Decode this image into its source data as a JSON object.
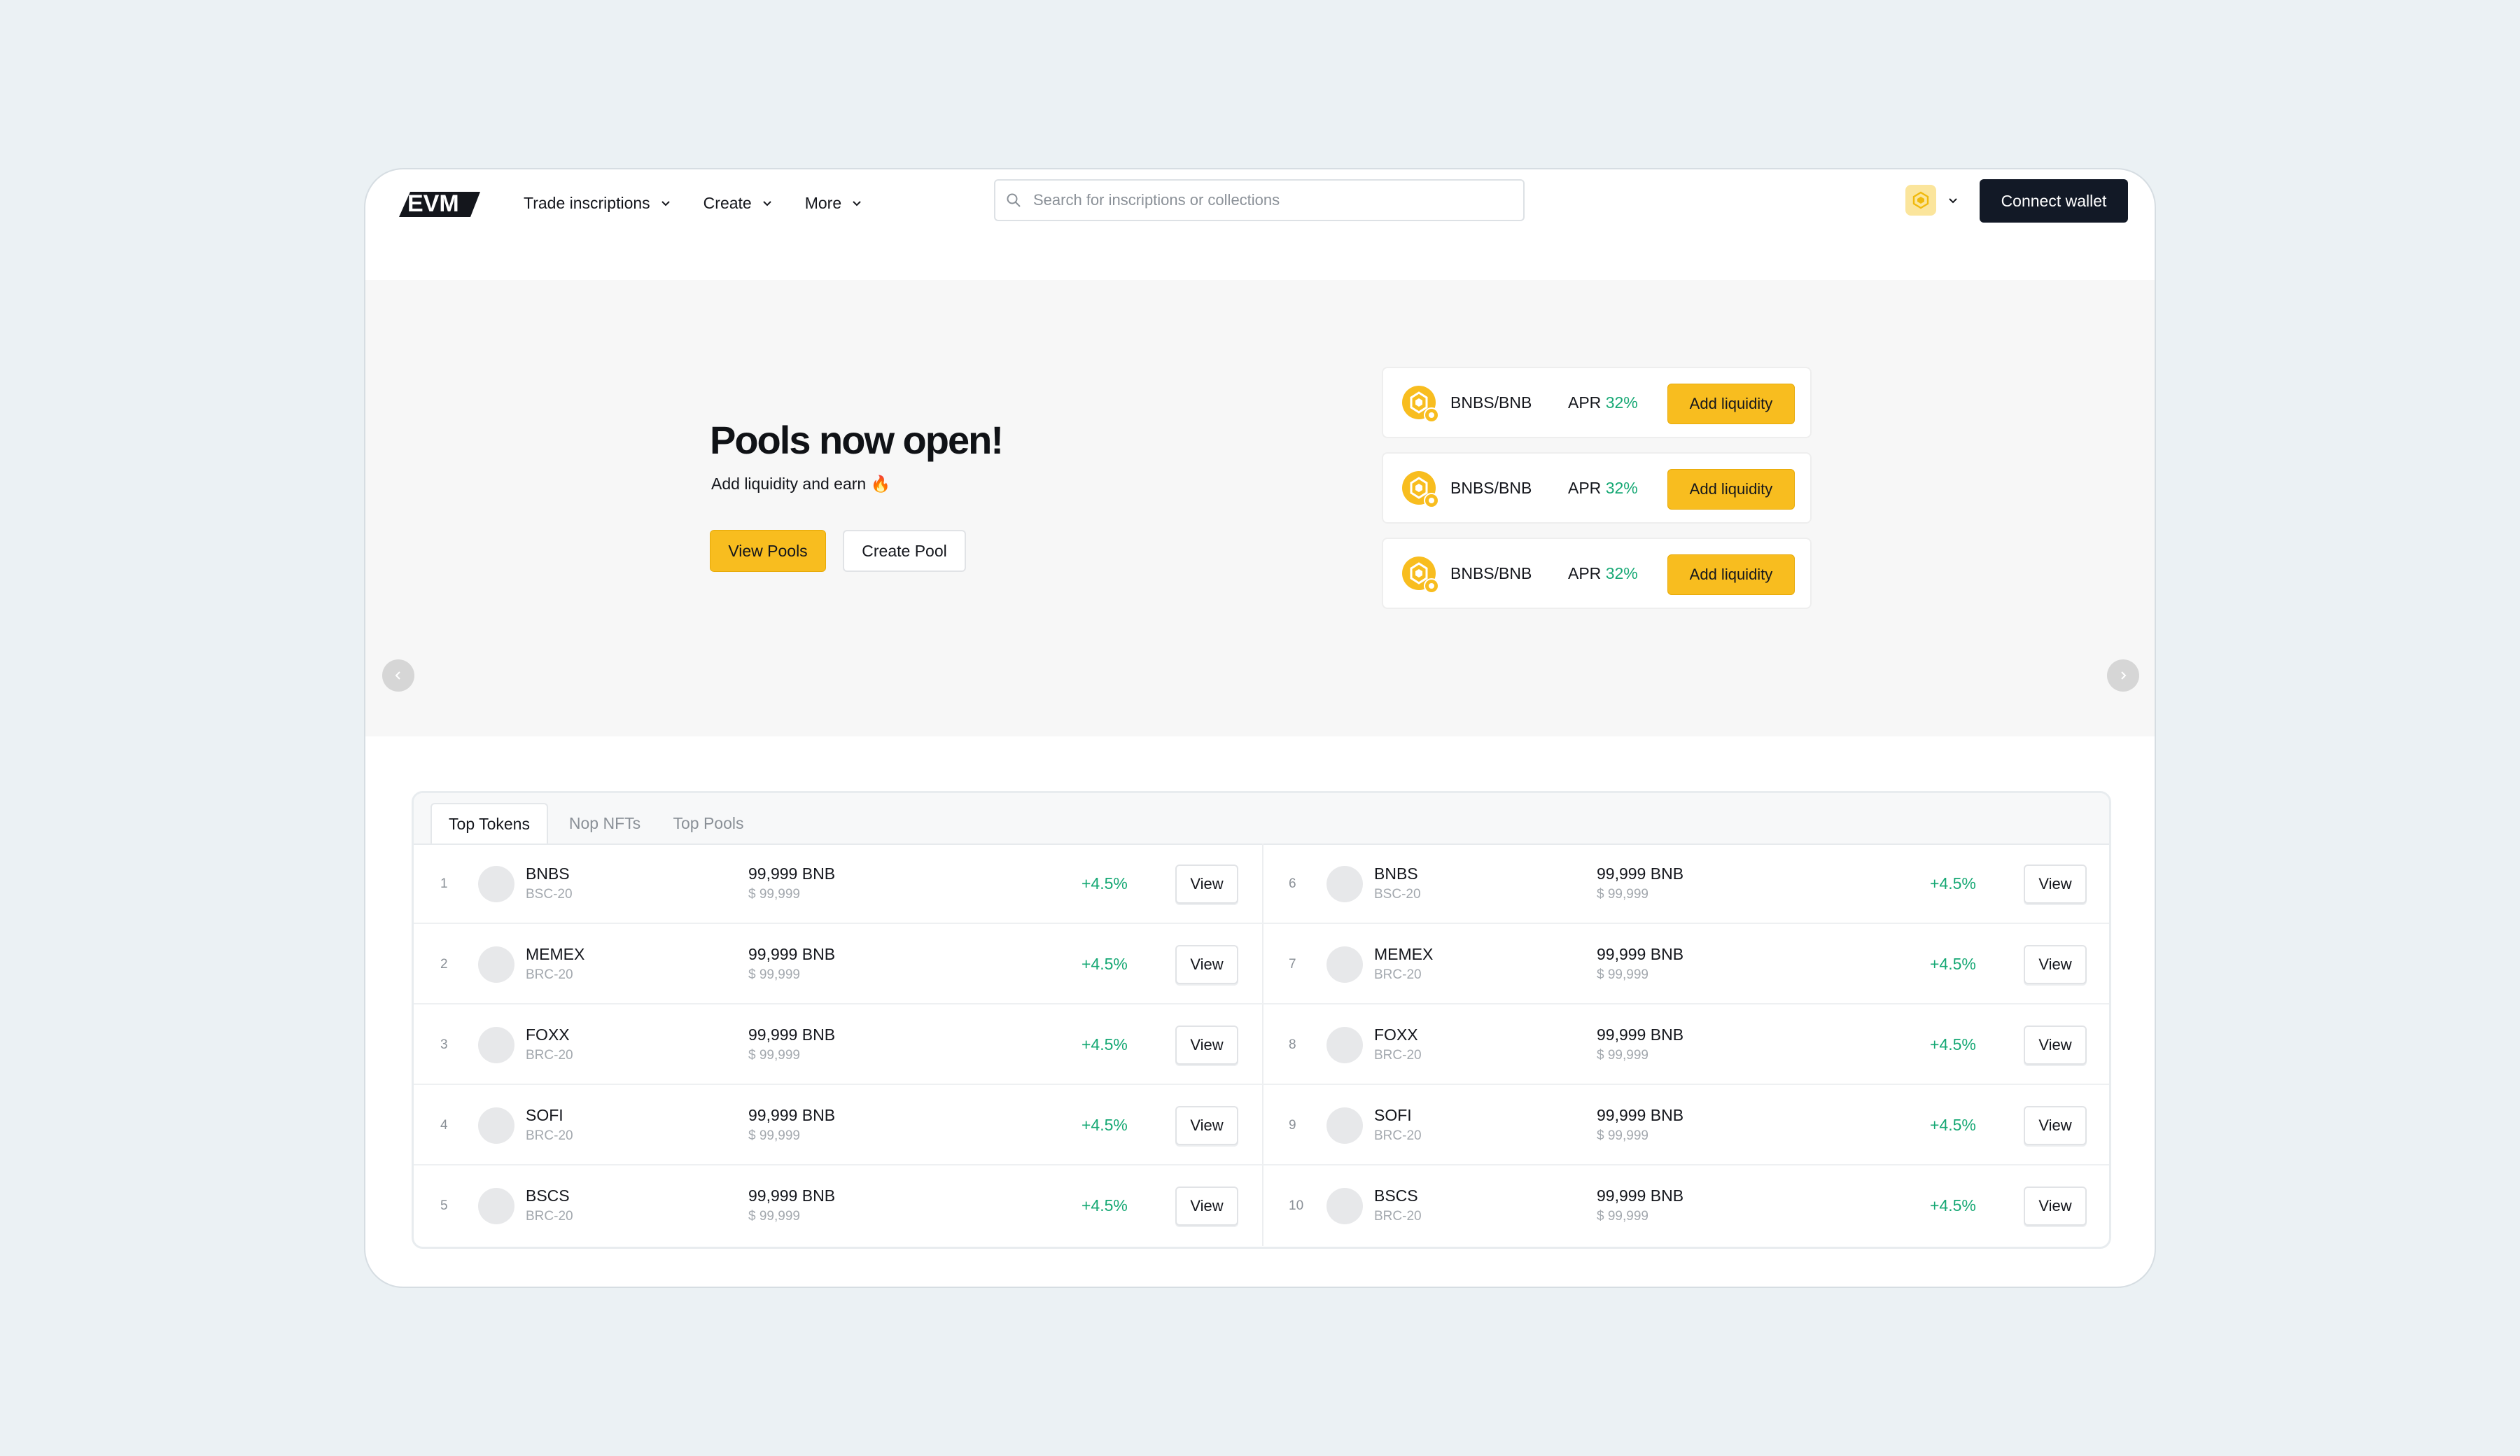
{
  "nav": {
    "logo_text": "EVM",
    "menu": [
      {
        "label": "Trade inscriptions"
      },
      {
        "label": "Create"
      },
      {
        "label": "More"
      }
    ],
    "search_placeholder": "Search for inscriptions or collections",
    "connect_label": "Connect wallet"
  },
  "hero": {
    "title": "Pools now open!",
    "subtitle": "Add liquidity and earn 🔥",
    "primary_label": "View Pools",
    "secondary_label": "Create Pool",
    "slide_count": 4,
    "active_slide": 1,
    "pools": [
      {
        "pair": "BNBS/BNB",
        "apr_label": "APR",
        "apr_value": "32%",
        "action": "Add liquidity"
      },
      {
        "pair": "BNBS/BNB",
        "apr_label": "APR",
        "apr_value": "32%",
        "action": "Add liquidity"
      },
      {
        "pair": "BNBS/BNB",
        "apr_label": "APR",
        "apr_value": "32%",
        "action": "Add liquidity"
      }
    ]
  },
  "table": {
    "tabs": [
      {
        "label": "Top Tokens",
        "active": true
      },
      {
        "label": "Nop NFTs",
        "active": false
      },
      {
        "label": "Top Pools",
        "active": false
      }
    ],
    "left_rows": [
      {
        "rank": "1",
        "name": "BNBS",
        "standard": "BSC-20",
        "price": "99,999 BNB",
        "usd": "$ 99,999",
        "change": "+4.5%",
        "action": "View"
      },
      {
        "rank": "2",
        "name": "MEMEX",
        "standard": "BRC-20",
        "price": "99,999 BNB",
        "usd": "$ 99,999",
        "change": "+4.5%",
        "action": "View"
      },
      {
        "rank": "3",
        "name": "FOXX",
        "standard": "BRC-20",
        "price": "99,999 BNB",
        "usd": "$ 99,999",
        "change": "+4.5%",
        "action": "View"
      },
      {
        "rank": "4",
        "name": "SOFI",
        "standard": "BRC-20",
        "price": "99,999 BNB",
        "usd": "$ 99,999",
        "change": "+4.5%",
        "action": "View"
      },
      {
        "rank": "5",
        "name": "BSCS",
        "standard": "BRC-20",
        "price": "99,999 BNB",
        "usd": "$ 99,999",
        "change": "+4.5%",
        "action": "View"
      }
    ],
    "right_rows": [
      {
        "rank": "6",
        "name": "BNBS",
        "standard": "BSC-20",
        "price": "99,999 BNB",
        "usd": "$ 99,999",
        "change": "+4.5%",
        "action": "View"
      },
      {
        "rank": "7",
        "name": "MEMEX",
        "standard": "BRC-20",
        "price": "99,999 BNB",
        "usd": "$ 99,999",
        "change": "+4.5%",
        "action": "View"
      },
      {
        "rank": "8",
        "name": "FOXX",
        "standard": "BRC-20",
        "price": "99,999 BNB",
        "usd": "$ 99,999",
        "change": "+4.5%",
        "action": "View"
      },
      {
        "rank": "9",
        "name": "SOFI",
        "standard": "BRC-20",
        "price": "99,999 BNB",
        "usd": "$ 99,999",
        "change": "+4.5%",
        "action": "View"
      },
      {
        "rank": "10",
        "name": "BSCS",
        "standard": "BRC-20",
        "price": "99,999 BNB",
        "usd": "$ 99,999",
        "change": "+4.5%",
        "action": "View"
      }
    ]
  },
  "colors": {
    "accent": "#f8bd1f",
    "positive": "#16a874",
    "dark_button": "#121926"
  },
  "icons": {
    "nav_dropdown": "chevron-down-icon",
    "search": "search-icon",
    "chain": "bnb-chain-icon",
    "pool": "bnb-token-icon",
    "prev": "chevron-left-icon",
    "next": "chevron-right-icon"
  }
}
